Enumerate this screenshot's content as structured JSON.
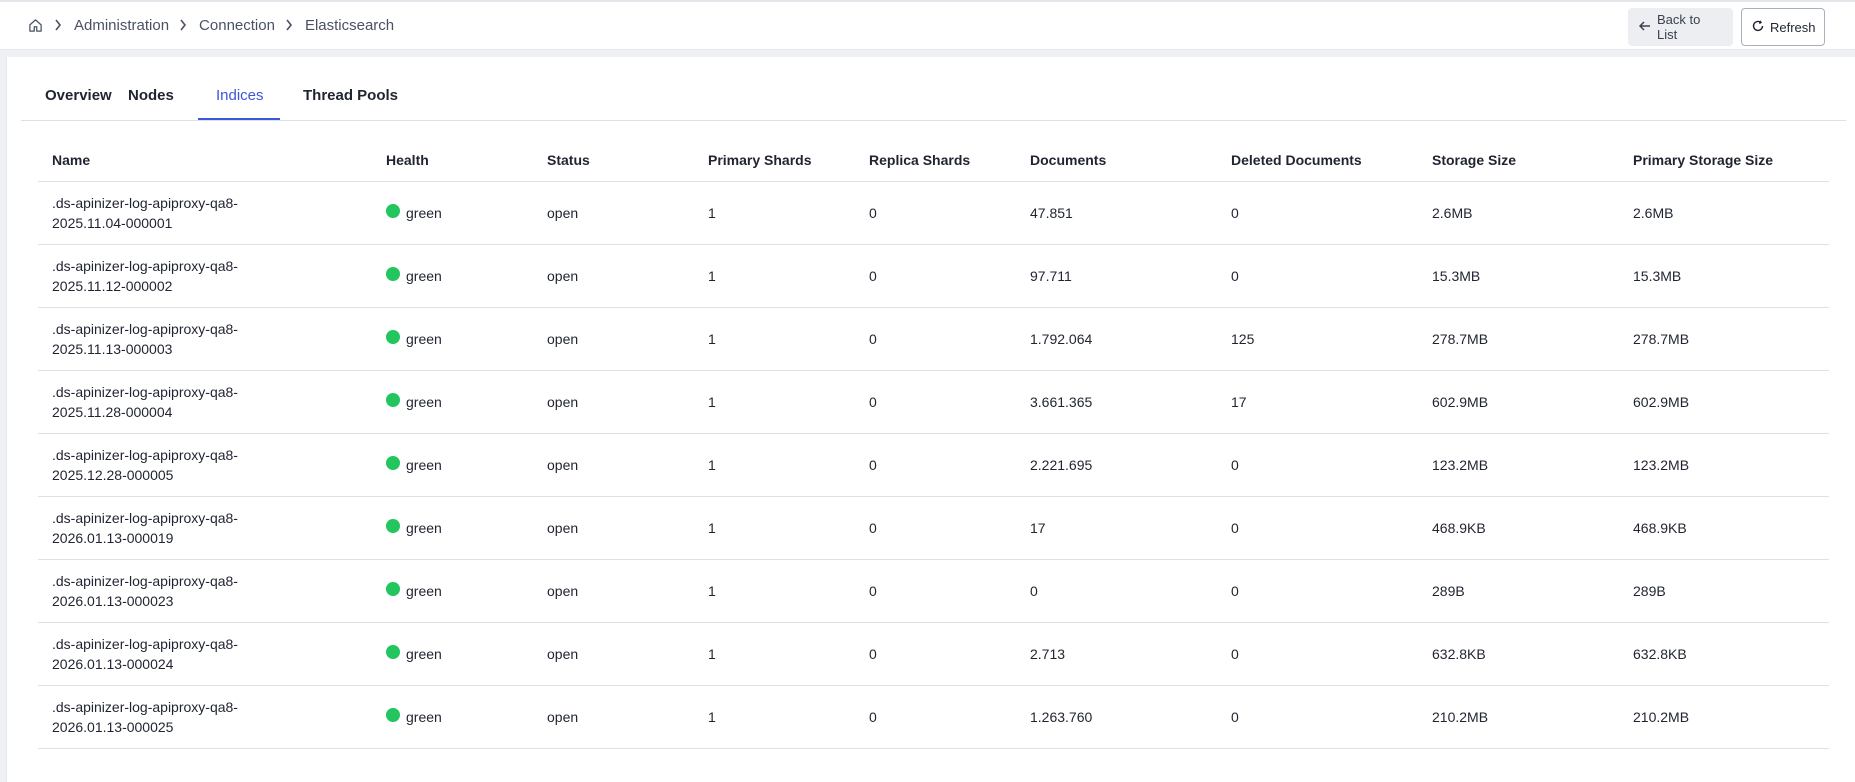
{
  "breadcrumb": {
    "items": [
      "Administration",
      "Connection",
      "Elasticsearch"
    ]
  },
  "actions": {
    "back_label": "Back to List",
    "refresh_label": "Refresh"
  },
  "tabs": [
    {
      "label": "Overview"
    },
    {
      "label": "Nodes"
    },
    {
      "label": "Indices",
      "active": true
    },
    {
      "label": "Thread Pools"
    }
  ],
  "table": {
    "columns": [
      "Name",
      "Health",
      "Status",
      "Primary Shards",
      "Replica Shards",
      "Documents",
      "Deleted Documents",
      "Storage Size",
      "Primary Storage Size"
    ],
    "rows": [
      {
        "name": ".ds-apinizer-log-apiproxy-qa8-2025.11.04-000001",
        "health": "green",
        "status": "open",
        "primary_shards": "1",
        "replica_shards": "0",
        "documents": "47.851",
        "deleted_documents": "0",
        "storage_size": "2.6MB",
        "primary_storage_size": "2.6MB"
      },
      {
        "name": ".ds-apinizer-log-apiproxy-qa8-2025.11.12-000002",
        "health": "green",
        "status": "open",
        "primary_shards": "1",
        "replica_shards": "0",
        "documents": "97.711",
        "deleted_documents": "0",
        "storage_size": "15.3MB",
        "primary_storage_size": "15.3MB"
      },
      {
        "name": ".ds-apinizer-log-apiproxy-qa8-2025.11.13-000003",
        "health": "green",
        "status": "open",
        "primary_shards": "1",
        "replica_shards": "0",
        "documents": "1.792.064",
        "deleted_documents": "125",
        "storage_size": "278.7MB",
        "primary_storage_size": "278.7MB"
      },
      {
        "name": ".ds-apinizer-log-apiproxy-qa8-2025.11.28-000004",
        "health": "green",
        "status": "open",
        "primary_shards": "1",
        "replica_shards": "0",
        "documents": "3.661.365",
        "deleted_documents": "17",
        "storage_size": "602.9MB",
        "primary_storage_size": "602.9MB"
      },
      {
        "name": ".ds-apinizer-log-apiproxy-qa8-2025.12.28-000005",
        "health": "green",
        "status": "open",
        "primary_shards": "1",
        "replica_shards": "0",
        "documents": "2.221.695",
        "deleted_documents": "0",
        "storage_size": "123.2MB",
        "primary_storage_size": "123.2MB"
      },
      {
        "name": ".ds-apinizer-log-apiproxy-qa8-2026.01.13-000019",
        "health": "green",
        "status": "open",
        "primary_shards": "1",
        "replica_shards": "0",
        "documents": "17",
        "deleted_documents": "0",
        "storage_size": "468.9KB",
        "primary_storage_size": "468.9KB"
      },
      {
        "name": ".ds-apinizer-log-apiproxy-qa8-2026.01.13-000023",
        "health": "green",
        "status": "open",
        "primary_shards": "1",
        "replica_shards": "0",
        "documents": "0",
        "deleted_documents": "0",
        "storage_size": "289B",
        "primary_storage_size": "289B"
      },
      {
        "name": ".ds-apinizer-log-apiproxy-qa8-2026.01.13-000024",
        "health": "green",
        "status": "open",
        "primary_shards": "1",
        "replica_shards": "0",
        "documents": "2.713",
        "deleted_documents": "0",
        "storage_size": "632.8KB",
        "primary_storage_size": "632.8KB"
      },
      {
        "name": ".ds-apinizer-log-apiproxy-qa8-2026.01.13-000025",
        "health": "green",
        "status": "open",
        "primary_shards": "1",
        "replica_shards": "0",
        "documents": "1.263.760",
        "deleted_documents": "0",
        "storage_size": "210.2MB",
        "primary_storage_size": "210.2MB"
      }
    ]
  },
  "colors": {
    "accent": "#3b56d9",
    "health_green": "#22c55e"
  }
}
